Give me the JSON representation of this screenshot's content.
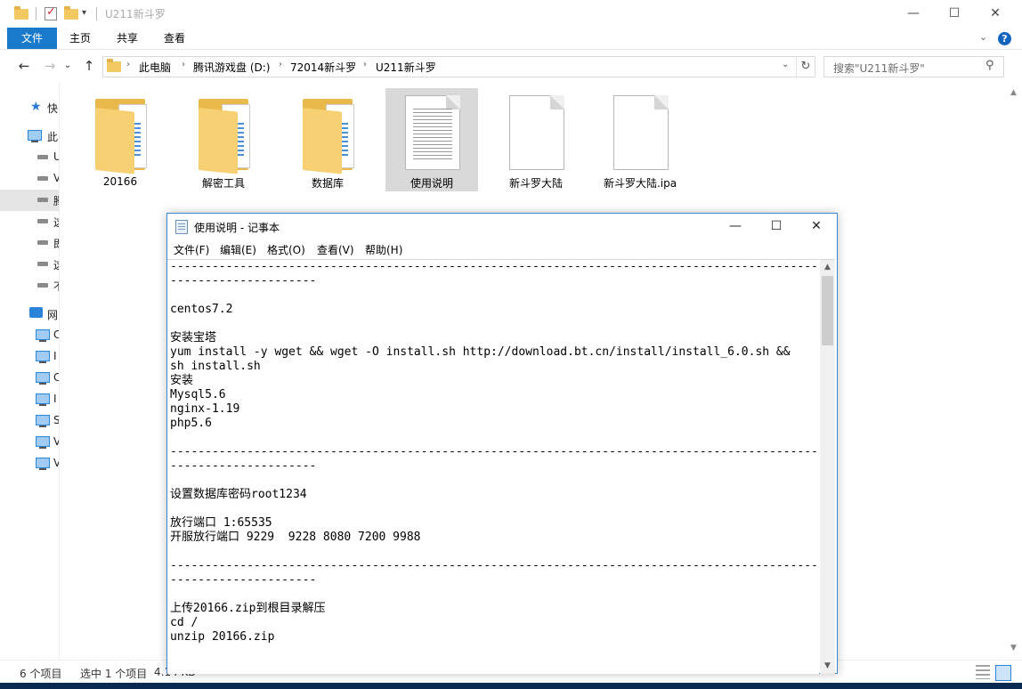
{
  "explorer": {
    "title": "U211新斗罗",
    "window_buttons": {
      "minimize": "—",
      "maximize": "☐",
      "close": "✕"
    },
    "ribbon": {
      "tabs": [
        {
          "label": "文件",
          "active": true
        },
        {
          "label": "主页",
          "active": false
        },
        {
          "label": "共享",
          "active": false
        },
        {
          "label": "查看",
          "active": false
        }
      ],
      "collapse_icon": "⌄",
      "help_icon": "?"
    },
    "nav": {
      "back": "←",
      "forward": "→",
      "recent": "⌄",
      "up": "↑"
    },
    "breadcrumb": [
      "此电脑",
      "腾讯游戏盘 (D:)",
      "72014新斗罗",
      "U211新斗罗"
    ],
    "crumb_separator": "›",
    "address_dropdown": "⌄",
    "refresh_icon": "↻",
    "search_placeholder": "搜索\"U211新斗罗\"",
    "search_icon": "⚲",
    "sidebar": {
      "items": [
        {
          "icon": "star-icon",
          "label": "快"
        },
        {
          "icon": "computer-icon",
          "label": "此"
        },
        {
          "icon": "drive-icon",
          "label": "U"
        },
        {
          "icon": "drive-icon",
          "label": "V"
        },
        {
          "icon": "drive-icon",
          "label": "腾"
        },
        {
          "icon": "drive-icon",
          "label": "这"
        },
        {
          "icon": "drive-icon",
          "label": "即"
        },
        {
          "icon": "drive-icon",
          "label": "这"
        },
        {
          "icon": "drive-icon",
          "label": "不"
        },
        {
          "icon": "network-icon",
          "label": "网"
        },
        {
          "icon": "monitor-icon",
          "label": "C"
        },
        {
          "icon": "monitor-icon",
          "label": "I"
        },
        {
          "icon": "monitor-icon",
          "label": "C"
        },
        {
          "icon": "monitor-icon",
          "label": "I"
        },
        {
          "icon": "monitor-icon",
          "label": "S"
        },
        {
          "icon": "monitor-icon",
          "label": "V"
        },
        {
          "icon": "monitor-icon",
          "label": "V"
        }
      ]
    },
    "files": [
      {
        "name": "20166",
        "type": "folder"
      },
      {
        "name": "解密工具",
        "type": "folder"
      },
      {
        "name": "数据库",
        "type": "folder"
      },
      {
        "name": "使用说明",
        "type": "text-document",
        "selected": true
      },
      {
        "name": "新斗罗大陆",
        "type": "file"
      },
      {
        "name": "新斗罗大陆.ipa",
        "type": "file"
      }
    ],
    "status": {
      "count": "6 个项目",
      "selection": "选中 1 个项目",
      "size": "4.14 KB"
    }
  },
  "notepad": {
    "title": "使用说明 - 记事本",
    "window_buttons": {
      "minimize": "—",
      "maximize": "☐",
      "close": "✕"
    },
    "menu": [
      "文件(F)",
      "编辑(E)",
      "格式(O)",
      "查看(V)",
      "帮助(H)"
    ],
    "content": "--------------------------------------------------------------------------------------------------------\n---------------------\n\ncentos7.2\n\n安装宝塔\nyum install -y wget && wget -O install.sh http://download.bt.cn/install/install_6.0.sh &&\nsh install.sh\n安装\nMysql5.6\nnginx-1.19\nphp5.6\n\n--------------------------------------------------------------------------------------------------------\n---------------------\n\n设置数据库密码root1234\n\n放行端口 1:65535\n开服放行端口 9229  9228 8080 7200 9988\n\n--------------------------------------------------------------------------------------------------------\n---------------------\n\n上传20166.zip到根目录解压\ncd /\nunzip 20166.zip",
    "scroll_up": "▲",
    "scroll_down": "▼"
  }
}
